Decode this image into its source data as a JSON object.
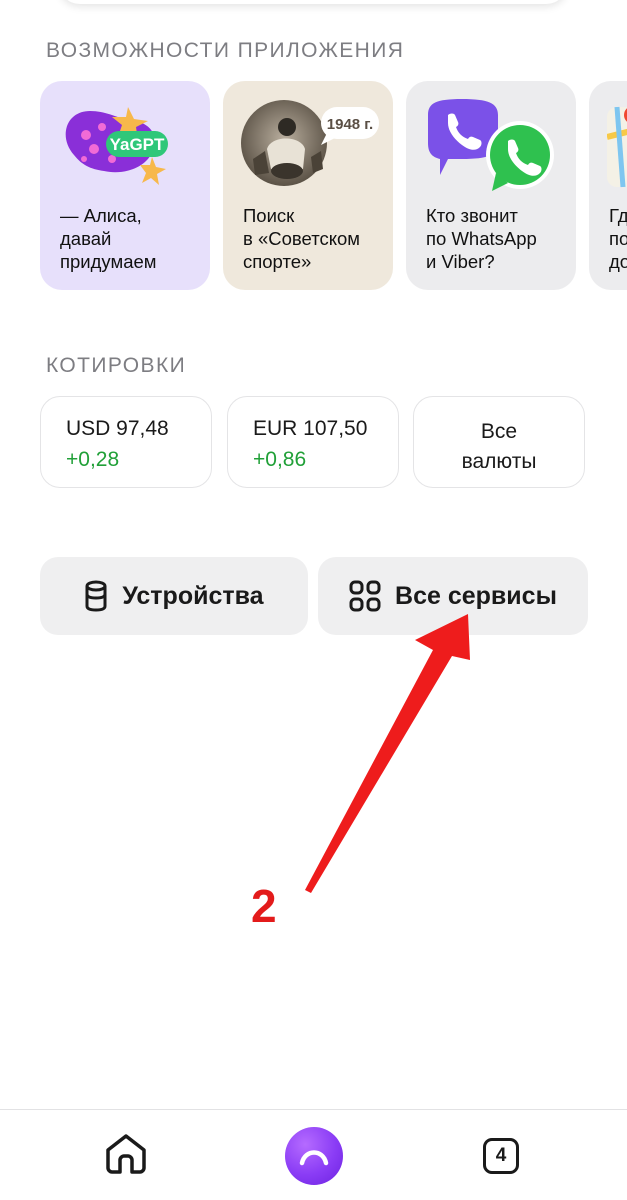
{
  "features": {
    "title": "ВОЗМОЖНОСТИ ПРИЛОЖЕНИЯ",
    "cards": [
      {
        "text": "— Алиса,\nдавай\nпридумаем",
        "badge": "YaGPT",
        "icon": "yagpt-logo-icon",
        "bg": "#e7e0fb"
      },
      {
        "text": "Поиск\nв «Советском\nспорте»",
        "badge": "1948 г.",
        "icon": "vintage-photo-icon",
        "bg": "#efe8dc"
      },
      {
        "text": "Кто звонит\nпо WhatsApp\nи Viber?",
        "icon": "viber-whatsapp-icon",
        "bg": "#ececee"
      },
      {
        "text": "Гд\nпо\nдо",
        "icon": "map-icon",
        "bg": "#ececee"
      }
    ]
  },
  "quotes": {
    "title": "КОТИРОВКИ",
    "items": [
      {
        "name": "USD 97,48",
        "delta": "+0,28"
      },
      {
        "name": "EUR 107,50",
        "delta": "+0,86"
      }
    ],
    "all_label": "Все\nвалюты",
    "delta_color": "#21a038"
  },
  "actions": {
    "devices_label": "Устройства",
    "services_label": "Все сервисы"
  },
  "annotation": {
    "number": "2",
    "color": "#e31b1b"
  },
  "nav": {
    "home_icon": "home-icon",
    "alice_icon": "alice-icon",
    "tabs_count": "4",
    "alice_color": "#8a3cf5"
  }
}
